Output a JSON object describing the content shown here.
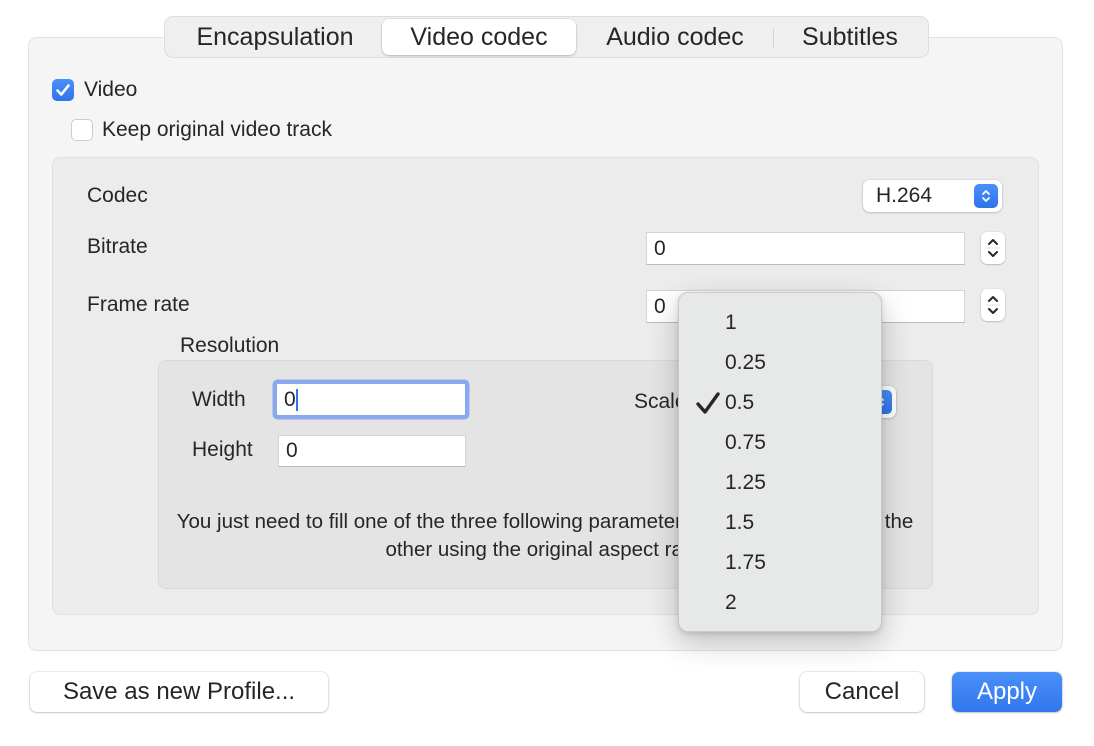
{
  "tabs": [
    {
      "label": "Encapsulation",
      "active": false
    },
    {
      "label": "Video codec",
      "active": true
    },
    {
      "label": "Audio codec",
      "active": false
    },
    {
      "label": "Subtitles",
      "active": false
    }
  ],
  "video": {
    "enable_label": "Video",
    "enable_checked": true,
    "keep_original_label": "Keep original video track",
    "keep_original_checked": false
  },
  "settings": {
    "codec_label": "Codec",
    "codec_value": "H.264",
    "bitrate_label": "Bitrate",
    "bitrate_value": "0",
    "framerate_label": "Frame rate",
    "framerate_value": "0"
  },
  "resolution": {
    "title": "Resolution",
    "width_label": "Width",
    "width_value": "0",
    "height_label": "Height",
    "height_value": "0",
    "scale_label": "Scale",
    "scale_value": "0.5",
    "description": "You just need to fill one of the three following parameters, VLC will autodetect the other using the original aspect ratio"
  },
  "scale_menu": {
    "items": [
      "1",
      "0.25",
      "0.5",
      "0.75",
      "1.25",
      "1.5",
      "1.75",
      "2"
    ],
    "selected": "0.5"
  },
  "footer": {
    "save_profile_label": "Save as new Profile...",
    "cancel_label": "Cancel",
    "apply_label": "Apply"
  },
  "colors": {
    "accent": "#3478f6",
    "panel_bg": "#f5f5f5",
    "menu_bg": "#e7e8e8"
  }
}
